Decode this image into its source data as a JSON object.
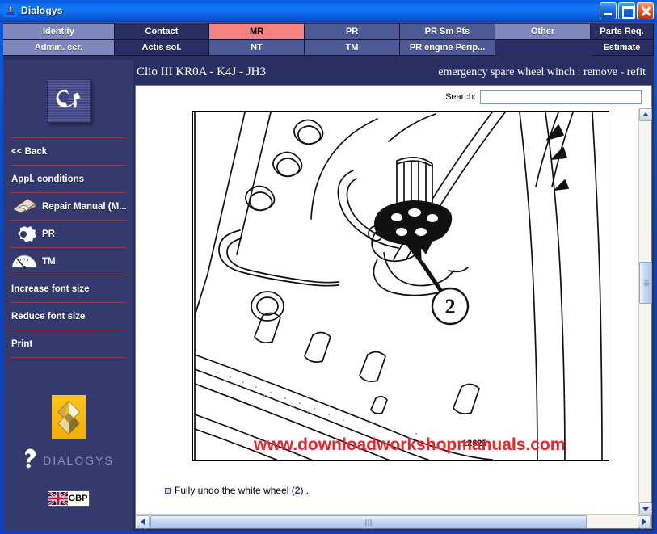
{
  "window": {
    "title": "Dialogys",
    "icon": "dialogys-icon",
    "minimize_label": "Minimize",
    "maximize_label": "Maximize",
    "close_label": "Close"
  },
  "tabs": {
    "row1": [
      {
        "label": "Identity",
        "state": "light"
      },
      {
        "label": "Contact",
        "state": "dark"
      },
      {
        "label": "MR",
        "state": "active"
      },
      {
        "label": "PR",
        "state": "mid"
      },
      {
        "label": "PR Sm Pts",
        "state": "mid"
      },
      {
        "label": "Other",
        "state": "light"
      },
      {
        "label": "Parts Req.",
        "state": "dark"
      }
    ],
    "row2": [
      {
        "label": "Admin. scr.",
        "state": "light"
      },
      {
        "label": "Actis sol.",
        "state": "dark"
      },
      {
        "label": "NT",
        "state": "mid"
      },
      {
        "label": "TM",
        "state": "mid"
      },
      {
        "label": "PR engine Perip...",
        "state": "mid"
      },
      {
        "label": "",
        "state": "empty"
      },
      {
        "label": "Estimate",
        "state": "dark"
      }
    ]
  },
  "sidebar": {
    "tool_logo_icon": "wrench-icon",
    "items": [
      {
        "label": "Back",
        "text": "<< Back",
        "icon": null
      },
      {
        "label": "Appl. conditions",
        "text": "Appl. conditions",
        "icon": null
      },
      {
        "label": "Repair Manual",
        "text": "Repair Manual (M...",
        "icon": "repair-manual-icon"
      },
      {
        "label": "PR",
        "text": "PR",
        "icon": "gear-icon"
      },
      {
        "label": "TM",
        "text": "TM",
        "icon": "gauge-icon"
      },
      {
        "label": "Increase font size",
        "text": "Increase font size",
        "icon": null
      },
      {
        "label": "Reduce font size",
        "text": "Reduce font size",
        "icon": null
      },
      {
        "label": "Print",
        "text": "Print",
        "icon": null
      }
    ],
    "brand": {
      "manufacturer_icon": "renault-diamond-icon",
      "product_name": "DIALOGYS",
      "product_mark_icon": "dialogys-question-mark-icon"
    },
    "language": {
      "flag_icon": "union-jack-flag-icon",
      "currency": "GBP"
    }
  },
  "document": {
    "vehicle": "Clio III KR0A - K4J - JH3",
    "procedure": "emergency spare wheel winch : remove - refit",
    "search": {
      "label": "Search:",
      "value": "",
      "placeholder": ""
    },
    "figure": {
      "alt": "Line drawing of spare wheel winch mechanism with callout marker",
      "callouts": [
        {
          "number": "2"
        }
      ],
      "reference_number": "12625",
      "watermark": "www.downloadworkshopmanuals.com",
      "watermark_color": "#e8262b"
    },
    "caption": {
      "bullet": "square-bullet-icon",
      "text_before": "Fully undo the white wheel (",
      "ref": "2",
      "text_after": ") ."
    }
  },
  "scrollbars": {
    "vertical": {
      "up": "scroll-up",
      "down": "scroll-down"
    },
    "horizontal": {
      "left": "scroll-left",
      "right": "scroll-right"
    }
  },
  "colors": {
    "titlebar": "#0d6ff2",
    "chrome": "#2a2f63",
    "sidebar": "#343a6e",
    "separator": "#8e3a52",
    "active_tab": "#f98080",
    "renault_yellow": "#f5ad00"
  }
}
